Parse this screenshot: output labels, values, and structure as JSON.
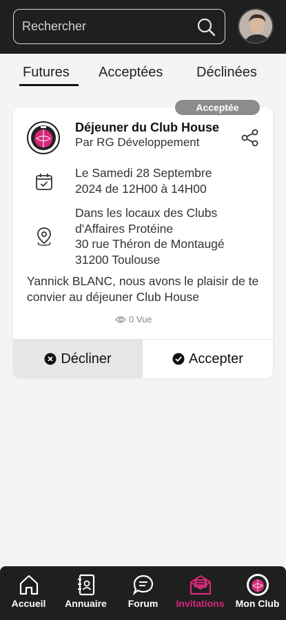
{
  "search": {
    "placeholder": "Rechercher"
  },
  "tabs": [
    {
      "label": "Futures",
      "active": true
    },
    {
      "label": "Acceptées",
      "active": false
    },
    {
      "label": "Déclinées",
      "active": false
    }
  ],
  "invitation": {
    "status_badge": "Acceptée",
    "title": "Déjeuner du Club House",
    "organizer": "Par RG Développement",
    "date_line1": "Le Samedi 28 Septembre",
    "date_line2": "2024 de 12H00 à 14H00",
    "place_lines": [
      "Dans les locaux des Clubs",
      "d'Affaires Protéine",
      "30 rue Théron de Montaugé",
      "31200 Toulouse"
    ],
    "message": "Yannick BLANC, nous avons le plaisir de te convier au déjeuner Club House",
    "views": "0 Vue",
    "decline_label": "Décliner",
    "accept_label": "Accepter"
  },
  "bottom_nav": [
    {
      "label": "Accueil",
      "icon": "home-icon",
      "active": false
    },
    {
      "label": "Annuaire",
      "icon": "directory-icon",
      "active": false
    },
    {
      "label": "Forum",
      "icon": "forum-icon",
      "active": false
    },
    {
      "label": "Invitations",
      "icon": "invitation-icon",
      "active": true
    },
    {
      "label": "Mon Club",
      "icon": "club-logo-icon",
      "active": false
    }
  ],
  "colors": {
    "accent": "#d6287a",
    "dark_bar": "#1f1f1f",
    "badge_grey": "#8c8c8c"
  }
}
